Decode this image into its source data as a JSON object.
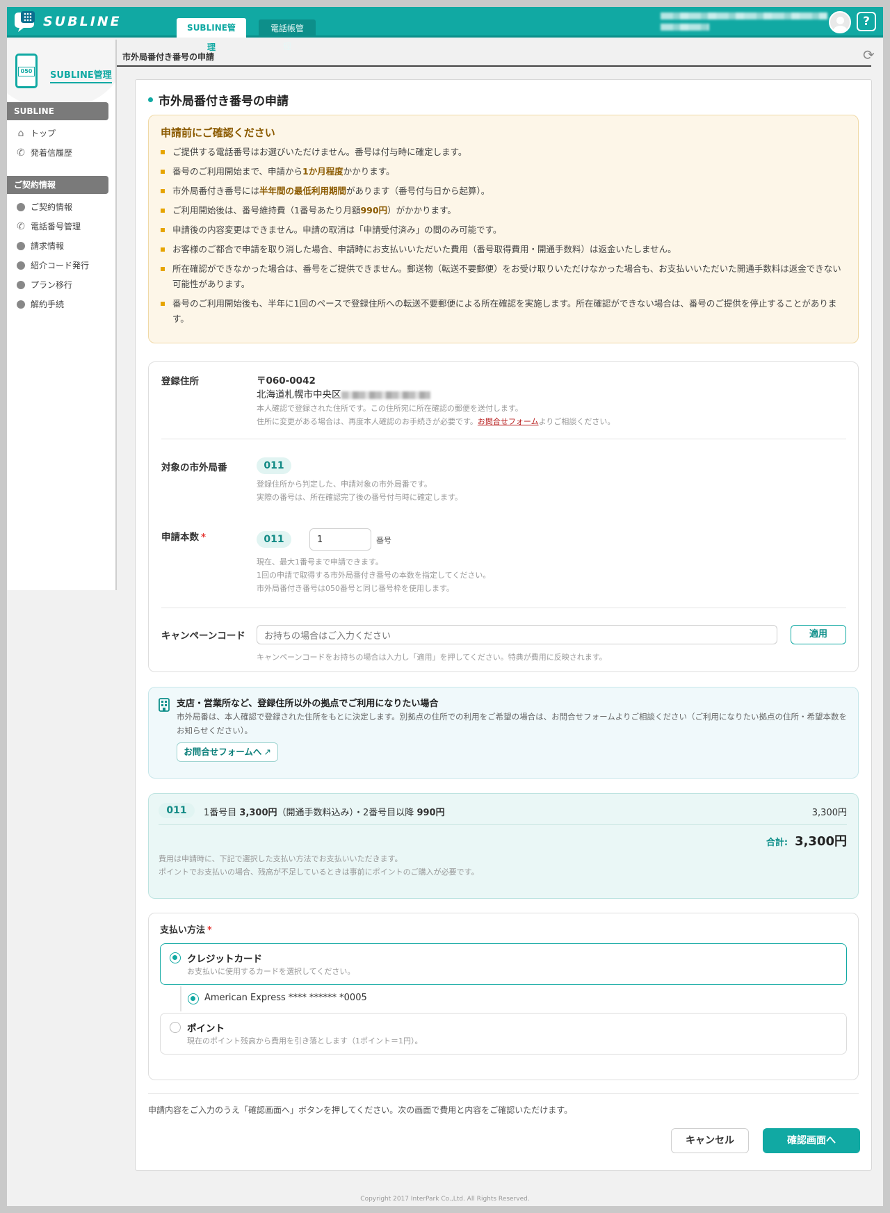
{
  "header": {
    "logo_text": "SUBLINE",
    "tabs": [
      {
        "label": "SUBLINE管理"
      },
      {
        "label": "電話帳管理"
      }
    ],
    "help_label": "?"
  },
  "sidebar": {
    "title": "SUBLINE管理",
    "phone_badge": "050",
    "groups": [
      {
        "label": "SUBLINE"
      },
      {
        "label": "ご契約情報"
      }
    ],
    "items": [
      {
        "label": "トップ"
      },
      {
        "label": "発着信履歴"
      },
      {
        "label": "ご契約情報"
      },
      {
        "label": "電話番号管理"
      },
      {
        "label": "請求情報"
      },
      {
        "label": "紹介コード発行"
      },
      {
        "label": "プラン移行"
      },
      {
        "label": "解約手続"
      }
    ]
  },
  "breadcrumb": "市外局番付き番号の申請",
  "page_title": "市外局番付き番号の申請",
  "notice": {
    "title": "申請前にご確認ください",
    "items": [
      {
        "pre": "ご提供する電話番号はお選びいただけません。番号は付与時に確定します。",
        "bold": "",
        "post": ""
      },
      {
        "pre": "番号のご利用開始まで、申請から",
        "bold": "1か月程度",
        "post": "かかります。"
      },
      {
        "pre": "市外局番付き番号には",
        "bold": "半年間の最低利用期間",
        "post": "があります（番号付与日から起算）。"
      },
      {
        "pre": "ご利用開始後は、番号維持費（1番号あたり月額",
        "bold": "990円",
        "post": "）がかかります。"
      },
      {
        "pre": "申請後の内容変更はできません。申請の取消は「申請受付済み」の間のみ可能です。",
        "bold": "",
        "post": ""
      },
      {
        "pre": "お客様のご都合で申請を取り消した場合、申請時にお支払いいただいた費用（番号取得費用・開通手数料）は返金いたしません。",
        "bold": "",
        "post": ""
      },
      {
        "pre": "所在確認ができなかった場合は、番号をご提供できません。郵送物（転送不要郵便）をお受け取りいただけなかった場合も、お支払いいただいた開通手数料は返金できない可能性があります。",
        "bold": "",
        "post": ""
      },
      {
        "pre": "番号のご利用開始後も、半年に1回のペースで登録住所への転送不要郵便による所在確認を実施します。所在確認ができない場合は、番号のご提供を停止することがあります。",
        "bold": "",
        "post": ""
      }
    ]
  },
  "form": {
    "address": {
      "label": "登録住所",
      "postal": "〒060-0042",
      "line": "北海道札幌市中央区",
      "note1": "本人確認で登録された住所です。この住所宛に所在確認の郵便を送付します。",
      "note2_pre": "住所に変更がある場合は、再度本人確認のお手続きが必要です。",
      "note2_link": "お問合せフォーム",
      "note2_post": "よりご相談ください。"
    },
    "area_code": {
      "label": "対象の市外局番",
      "value": "011",
      "note1": "登録住所から判定した、申請対象の市外局番です。",
      "note2": "実際の番号は、所在確認完了後の番号付与時に確定します。"
    },
    "quantity": {
      "label": "申請本数",
      "required": "*",
      "code": "011",
      "value": "1",
      "unit": "番号",
      "note1": "現在、最大1番号まで申請できます。",
      "note2": "1回の申請で取得する市外局番付き番号の本数を指定してください。",
      "note3": "市外局番付き番号は050番号と同じ番号枠を使用します。"
    },
    "campaign": {
      "label": "キャンペーンコード",
      "placeholder": "お持ちの場合はご入力ください",
      "apply_label": "適用",
      "note": "キャンペーンコードをお持ちの場合は入力し「適用」を押してください。特典が費用に反映されます。"
    }
  },
  "branch": {
    "title": "支店・営業所など、登録住所以外の拠点でご利用になりたい場合",
    "text": "市外局番は、本人確認で登録された住所をもとに決定します。別拠点の住所での利用をご希望の場合は、お問合せフォームよりご相談ください（ご利用になりたい拠点の住所・希望本数をお知らせください）。",
    "button": "お問合せフォームへ"
  },
  "price": {
    "code": "011",
    "desc_pre": "1番号目 ",
    "desc_b1": "3,300円",
    "desc_mid": "（開通手数料込み）・2番号目以降 ",
    "desc_b2": "990円",
    "amount": "3,300円",
    "total_label": "合計:",
    "total": "3,300円",
    "note1": "費用は申請時に、下記で選択した支払い方法でお支払いいただきます。",
    "note2": "ポイントでお支払いの場合、残高が不足しているときは事前にポイントのご購入が必要です。"
  },
  "payment": {
    "label": "支払い方法",
    "required": "*",
    "credit": {
      "label": "クレジットカード",
      "sub": "お支払いに使用するカードを選択してください。",
      "card": "American Express **** ****** *0005"
    },
    "point": {
      "label": "ポイント",
      "sub": "現在のポイント残高から費用を引き落とします（1ポイント＝1円）。"
    }
  },
  "footer": {
    "note": "申請内容をご入力のうえ「確認画面へ」ボタンを押してください。次の画面で費用と内容をご確認いただけます。",
    "cancel": "キャンセル",
    "confirm": "確認画面へ",
    "copyright": "Copyright 2017 InterPark Co.,Ltd. All Rights Reserved."
  },
  "colors": {
    "accent": "#11a9a3",
    "notice_bg": "#fdf6e8",
    "required": "#e53935"
  }
}
